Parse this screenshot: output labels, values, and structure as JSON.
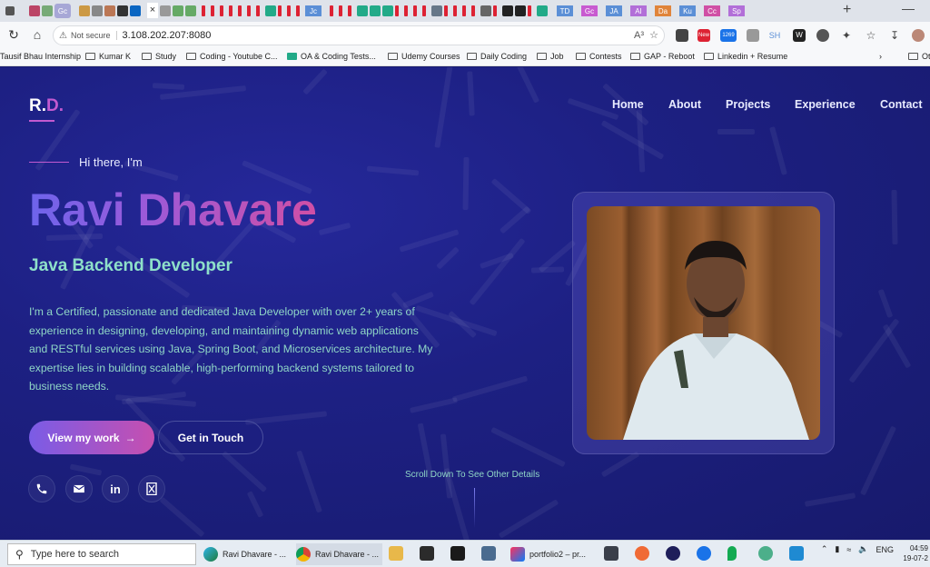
{
  "browser": {
    "tab_labels": [
      "Gc",
      "Jc",
      "TD",
      "Gc",
      "JA",
      "AI",
      "Da",
      "Ku",
      "Cc",
      "Sp"
    ],
    "new_tab": "+",
    "tab_close": "×",
    "minimize": "—",
    "security_label": "Not secure",
    "url": "3.108.202.207:8080",
    "read_aloud": "A³"
  },
  "bookmarks": [
    "Tausif Bhau Internship",
    "Kumar K",
    "Study",
    "Coding - Youtube C...",
    "OA & Coding Tests...",
    "Udemy Courses",
    "Daily Coding",
    "Job",
    "Contests",
    "GAP - Reboot",
    "Linkedin + Resume",
    "Ot"
  ],
  "extensions": {
    "badge_new": "New",
    "badge_count": "1269",
    "sh": "SH",
    "w": "W"
  },
  "site": {
    "logo_main": "R.",
    "logo_accent": "D.",
    "nav": [
      "Home",
      "About",
      "Projects",
      "Experience",
      "Contact"
    ],
    "greeting": "Hi there, I'm",
    "name": "Ravi Dhavare",
    "role": "Java Backend Developer",
    "bio": "I'm a Certified, passionate and dedicated Java Developer with over 2+ years of experience in designing, developing, and maintaining dynamic web applications and RESTful services using Java, Spring Boot, and Microservices architecture. My expertise lies in building scalable, high-performing backend systems tailored to business needs.",
    "btn_work": "View my work",
    "btn_work_arrow": "→",
    "btn_touch": "Get in Touch",
    "socials": [
      "phone-icon",
      "mail-icon",
      "linkedin-icon",
      "hourglass-icon"
    ],
    "linkedin_text": "in",
    "scroll_hint": "Scroll Down To See Other Details"
  },
  "taskbar": {
    "search_placeholder": "Type here to search",
    "apps": [
      "Ravi Dhavare - ...",
      "Ravi Dhavare - ...",
      "portfolio2 – pr..."
    ],
    "lang": "ENG",
    "time": "04:59",
    "date": "19-07-2"
  },
  "colors": {
    "bg": "#1b1e6e",
    "accent": "#c25ad0",
    "teal": "#8ee0c9"
  }
}
